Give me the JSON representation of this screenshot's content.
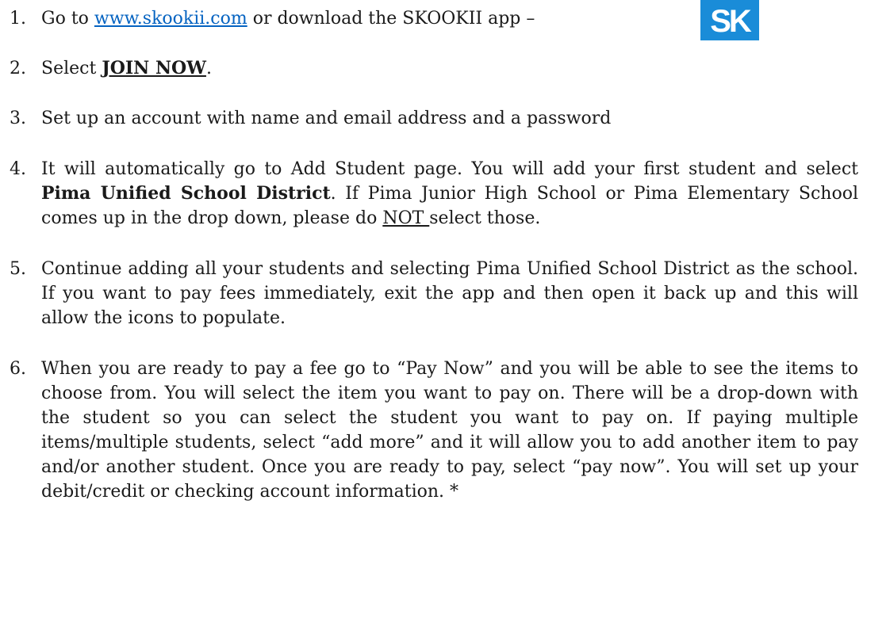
{
  "steps": [
    {
      "num": "1.",
      "pre": "Go to ",
      "link": "www.skookii.com",
      "post": " or download the SKOOKII app –"
    },
    {
      "num": "2.",
      "pre": "Select ",
      "strong": "JOIN NOW",
      "post": "."
    },
    {
      "num": "3.",
      "text": "Set up an account with name and email address and a password"
    },
    {
      "num": "4.",
      "pre": "It will automatically go to Add Student page.  You will add your first student and select ",
      "strong": "Pima Unified School District",
      "mid": ".  If Pima Junior High School or Pima Elementary School comes up in the drop down, please do ",
      "underline": "NOT ",
      "post": "select those."
    },
    {
      "num": "5.",
      "text": "Continue adding all your students and selecting Pima Unified School District as the school.  If you want to pay fees immediately, exit the app and then open it back up and this will allow the icons to populate."
    },
    {
      "num": "6.",
      "text": "When you are ready to pay a fee go to “Pay Now” and you will be able to see the items to choose from.  You will select the item you want to pay on.  There will be a drop-down with the student so you can select the student you want to pay on.  If paying multiple items/multiple students, select “add more” and it will allow you to add another item to pay and/or another student.  Once you are ready to pay, select “pay now”.  You will set up your debit/credit or checking account information. *"
    }
  ],
  "logo": {
    "text": "SK",
    "bg_color": "#1a8cd8"
  }
}
